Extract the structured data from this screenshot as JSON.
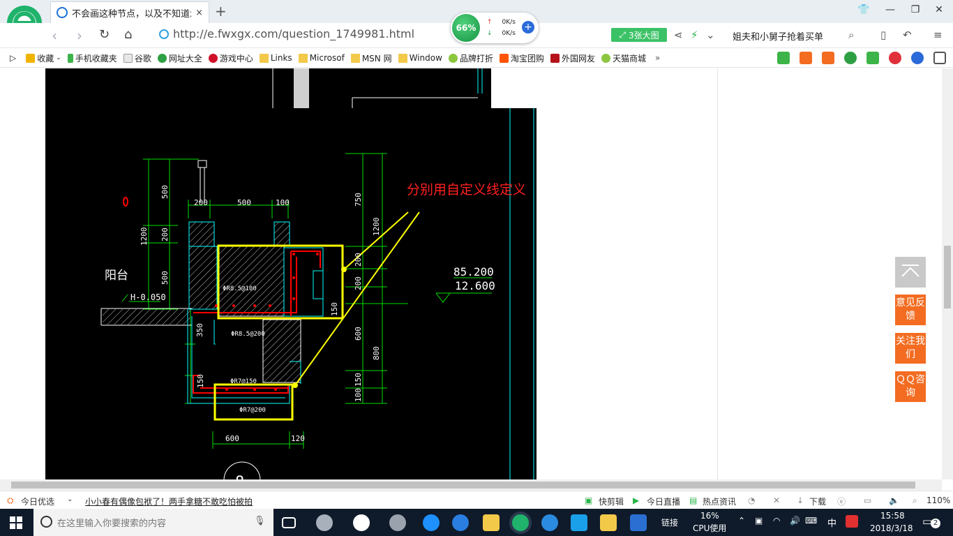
{
  "browser": {
    "tab_title": "不会画这种节点，以及不知道怎么",
    "tab_close": "×",
    "new_tab": "+",
    "url": "http://e.fwxgx.com/question_1749981.html",
    "speed_gauge": "66%",
    "upload_speed": "0K/s",
    "download_speed": "0K/s",
    "speed_plus": "+",
    "big_image_button": "3张大图",
    "search_suggestion": "姐夫和小舅子抢着买单"
  },
  "bookmarks": [
    {
      "label": "收藏",
      "color": "#f0b400"
    },
    {
      "label": "手机收藏夹",
      "color": "#3cb44a"
    },
    {
      "label": "谷歌",
      "color": "#bbbbbb"
    },
    {
      "label": "网址大全",
      "color": "#2ea043"
    },
    {
      "label": "游戏中心",
      "color": "#d0102a"
    },
    {
      "label": "Links",
      "color": "#f3c94a"
    },
    {
      "label": "Microsof",
      "color": "#f3c94a"
    },
    {
      "label": "MSN 网",
      "color": "#f3c94a"
    },
    {
      "label": "Window",
      "color": "#f3c94a"
    },
    {
      "label": "品牌打折",
      "color": "#8cc63f"
    },
    {
      "label": "淘宝团购",
      "color": "#ff5500"
    },
    {
      "label": "外国网友",
      "color": "#b5121b"
    },
    {
      "label": "天猫商城",
      "color": "#8cc63f"
    }
  ],
  "bookmarks_more": "»",
  "drawing": {
    "annotation": "分别用自定义线定义",
    "balcony_label": "阳台",
    "level_label": "H-0.050",
    "elevation_top": "85.200",
    "elevation_bottom": "12.600",
    "dim_top": [
      "200",
      "500",
      "100"
    ],
    "dim_left_total": "1200",
    "dim_left": [
      "500",
      "200",
      "500"
    ],
    "dim_right_total": "1200",
    "dim_right": [
      "750",
      "200",
      "200",
      "150",
      "600",
      "800",
      "150",
      "100"
    ],
    "dim_bottom": [
      "600",
      "120"
    ],
    "dim_350": "350",
    "dim_150": "150",
    "rebar_1": "ΦR8.5@100",
    "rebar_2": "ΦR8.5@200",
    "rebar_3": "ΦR7@150",
    "rebar_4": "ΦR7@200",
    "marker": "8"
  },
  "sidebar": {
    "feedback": "意见反馈",
    "follow": "关注我们",
    "qq": "ＱＱ咨询"
  },
  "statusbar": {
    "today_pick": "今日优选",
    "news": "小小春有偶像包袱了！两手拿糖不敢吃怕被拍",
    "quick_clip": "快剪辑",
    "today_live": "今日直播",
    "hot_news": "热点资讯",
    "download": "下载",
    "zoom": "110%"
  },
  "taskbar": {
    "search_placeholder": "在这里输入你要搜索的内容",
    "link_label": "链接",
    "cpu_percent": "16%",
    "cpu_label": "CPU使用",
    "ime": "中",
    "time": "15:58",
    "date": "2018/3/18",
    "notifications": "2"
  },
  "colors": {
    "drawing_bg": "#000000",
    "cad_cyan": "#00ffff",
    "cad_green": "#00e000",
    "cad_red": "#ff0000",
    "highlight_yellow": "#ffff00",
    "side_orange": "#f36c21"
  }
}
